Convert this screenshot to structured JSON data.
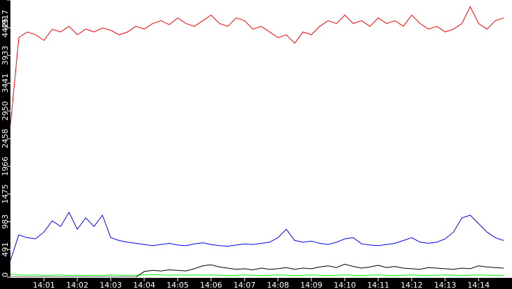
{
  "chart_data": {
    "type": "line",
    "title": "",
    "xlabel": "",
    "ylabel": "",
    "ylim": [
      0,
      4917
    ],
    "xlim_minutes": [
      0,
      15
    ],
    "y_ticks": [
      "0",
      "491",
      "983",
      "1475",
      "1966",
      "2458",
      "2950",
      "3441",
      "3933",
      "4425",
      "4917"
    ],
    "y_tick_values": [
      0,
      491,
      983,
      1475,
      1966,
      2458,
      2950,
      3441,
      3933,
      4425,
      4917
    ],
    "x_ticks": [
      "14:01",
      "14:02",
      "14:03",
      "14:04",
      "14:05",
      "14:06",
      "14:07",
      "14:08",
      "14:09",
      "14:10",
      "14:11",
      "14:12",
      "14:13",
      "14:14"
    ],
    "x_tick_minutes": [
      1,
      2,
      3,
      4,
      5,
      6,
      7,
      8,
      9,
      10,
      11,
      12,
      13,
      14
    ],
    "sample_interval_seconds": 15,
    "grid": false,
    "series": [
      {
        "name": "red",
        "color": "#ff0000",
        "values": [
          2700,
          4250,
          4350,
          4300,
          4200,
          4400,
          4350,
          4450,
          4300,
          4400,
          4350,
          4420,
          4380,
          4300,
          4350,
          4450,
          4400,
          4500,
          4550,
          4480,
          4600,
          4500,
          4450,
          4550,
          4650,
          4500,
          4450,
          4600,
          4550,
          4400,
          4450,
          4350,
          4250,
          4300,
          4150,
          4350,
          4300,
          4450,
          4550,
          4500,
          4650,
          4500,
          4550,
          4450,
          4600,
          4500,
          4550,
          4450,
          4650,
          4500,
          4400,
          4450,
          4350,
          4400,
          4500,
          4800,
          4500,
          4400,
          4550,
          4600
        ]
      },
      {
        "name": "blue",
        "color": "#0000ff",
        "values": [
          300,
          750,
          700,
          680,
          800,
          1000,
          900,
          1150,
          850,
          1050,
          900,
          1100,
          700,
          650,
          620,
          600,
          580,
          560,
          580,
          600,
          570,
          560,
          590,
          610,
          580,
          560,
          550,
          570,
          590,
          580,
          600,
          620,
          700,
          850,
          650,
          620,
          640,
          600,
          580,
          620,
          680,
          700,
          590,
          570,
          560,
          580,
          600,
          650,
          700,
          620,
          600,
          620,
          680,
          800,
          1050,
          1100,
          950,
          800,
          700,
          650
        ]
      },
      {
        "name": "black",
        "color": "#000000",
        "values": [
          0,
          0,
          0,
          0,
          0,
          0,
          0,
          0,
          0,
          0,
          0,
          0,
          0,
          0,
          0,
          0,
          100,
          120,
          110,
          130,
          120,
          110,
          150,
          200,
          220,
          180,
          160,
          140,
          150,
          130,
          160,
          140,
          150,
          170,
          140,
          160,
          150,
          180,
          200,
          170,
          230,
          190,
          160,
          180,
          210,
          170,
          190,
          160,
          150,
          140,
          170,
          160,
          150,
          140,
          160,
          150,
          200,
          180,
          170,
          160
        ]
      },
      {
        "name": "green",
        "color": "#00ff00",
        "values": [
          50,
          40,
          35,
          40,
          30,
          35,
          40,
          30,
          35,
          30,
          35,
          30,
          40,
          35,
          30,
          35,
          40,
          45,
          40,
          35,
          40,
          35,
          40,
          35,
          40,
          35,
          30,
          35,
          40,
          35,
          30,
          35,
          40,
          35,
          30,
          35,
          40,
          35,
          30,
          35,
          40,
          35,
          30,
          35,
          40,
          35,
          30,
          35,
          40,
          35,
          30,
          35,
          40,
          35,
          30,
          35,
          40,
          35,
          30,
          35
        ]
      }
    ]
  }
}
